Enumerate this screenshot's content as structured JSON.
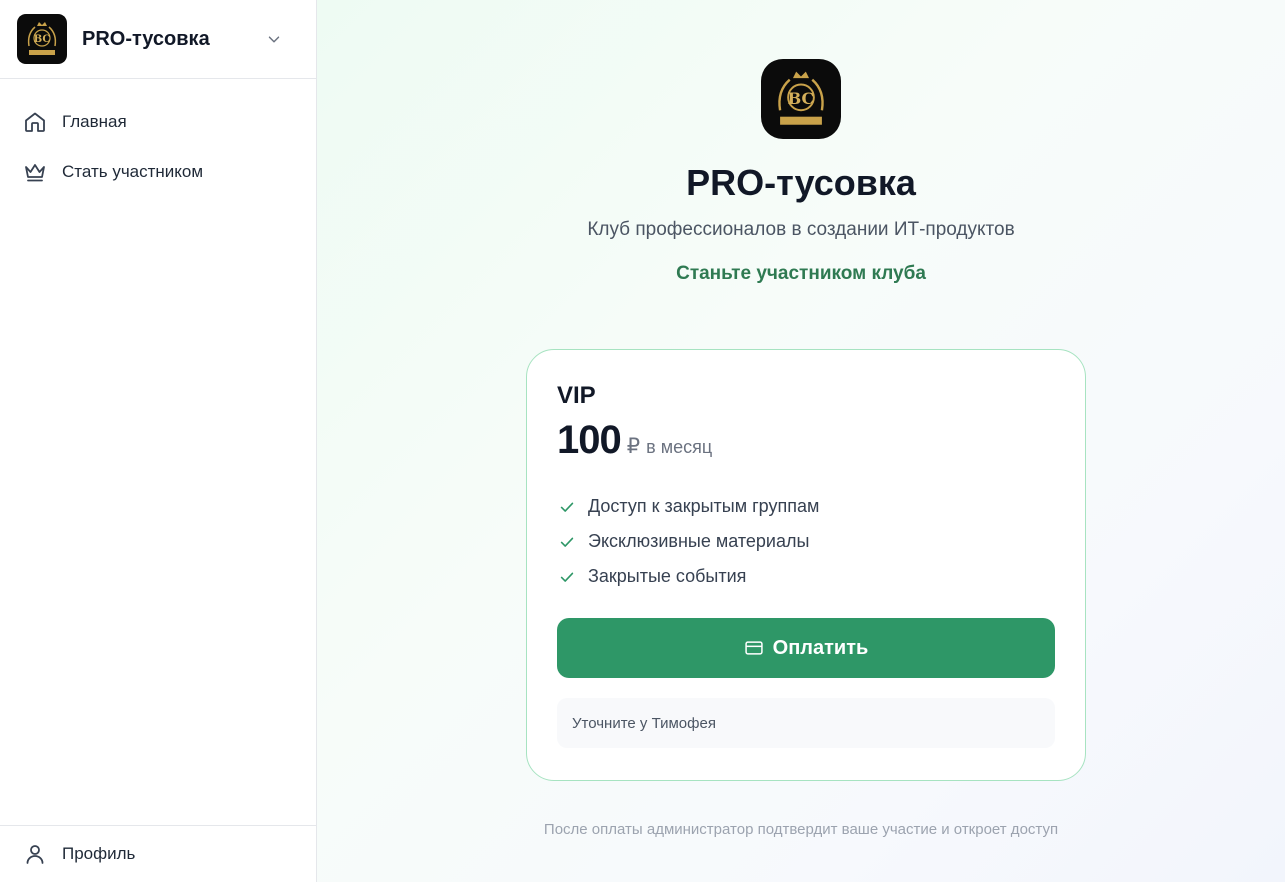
{
  "sidebar": {
    "club_name": "PRO-тусовка",
    "logo_alt": "BUSINESS CLUB",
    "items": [
      {
        "label": "Главная",
        "icon": "home-icon"
      },
      {
        "label": "Стать участником",
        "icon": "crown-icon"
      }
    ],
    "footer": {
      "label": "Профиль",
      "icon": "user-icon"
    }
  },
  "hero": {
    "title": "PRO-тусовка",
    "subtitle": "Клуб профессионалов в создании ИТ-продуктов",
    "cta": "Станьте участником клуба"
  },
  "plan": {
    "name": "VIP",
    "price": "100",
    "currency": "₽",
    "period": "в месяц",
    "features": [
      "Доступ к закрытым группам",
      "Эксклюзивные материалы",
      "Закрытые события"
    ],
    "pay_label": "Оплатить",
    "note": "Уточните у Тимофея"
  },
  "footer_note": "После оплаты администратор подтвердит ваше участие и откроет доступ",
  "colors": {
    "accent": "#2e9767",
    "cta_text": "#2f7a52",
    "card_border": "#a7e3c1"
  }
}
